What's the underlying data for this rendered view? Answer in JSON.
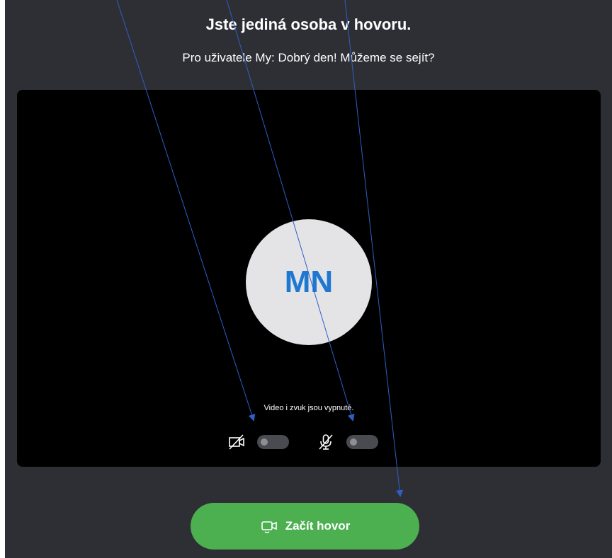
{
  "call": {
    "title": "Jste jediná osoba v hovoru.",
    "message": "Pro uživatele My: Dobrý den! Můžeme se sejít?"
  },
  "preview": {
    "avatar_initials": "MN",
    "status_text": "Video i zvuk jsou vypnuté.",
    "camera_toggle": {
      "icon": "camera-off-icon",
      "state": "off"
    },
    "mic_toggle": {
      "icon": "mic-off-icon",
      "state": "off"
    }
  },
  "actions": {
    "start_call_label": "Začít hovor",
    "start_call_icon": "video-call-icon"
  },
  "colors": {
    "background": "#2d2f35",
    "preview": "#000000",
    "avatar_bg": "#e4e4e7",
    "avatar_text": "#1e78d2",
    "button": "#4caf50",
    "annotation_arrow": "#2f5fc4"
  }
}
